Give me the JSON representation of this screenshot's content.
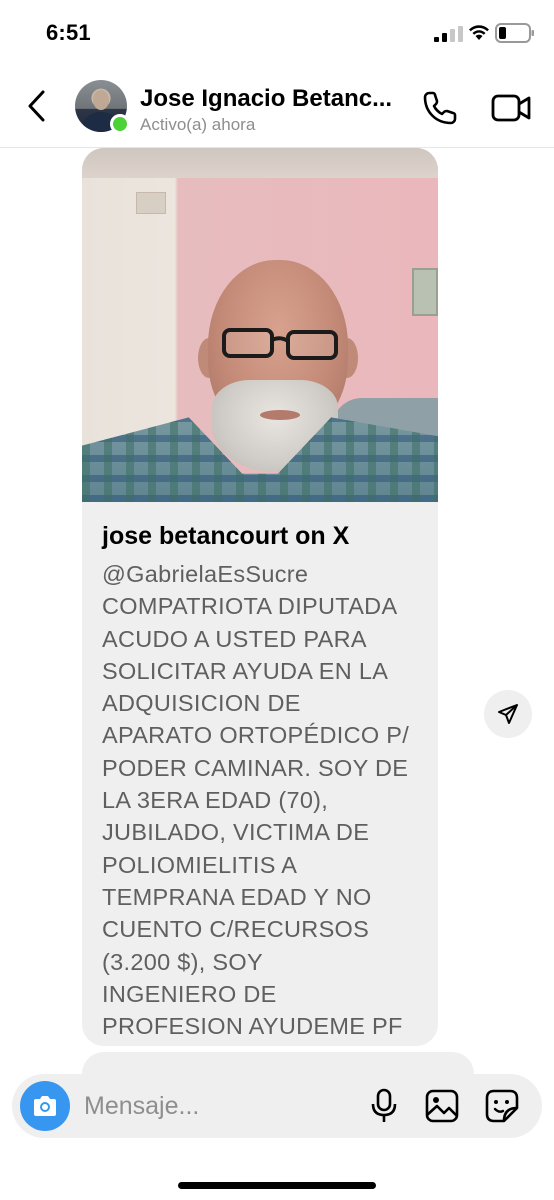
{
  "status_bar": {
    "time": "6:51",
    "signal_icon": "cellular-signal-icon",
    "wifi_icon": "wifi-icon",
    "battery_icon": "battery-low-icon"
  },
  "header": {
    "back_icon": "chevron-left-icon",
    "contact_name": "Jose Ignacio Betanc...",
    "contact_status": "Activo(a) ahora",
    "online_color": "#4cd137",
    "call_icon": "phone-icon",
    "video_icon": "video-camera-icon"
  },
  "message": {
    "shared_post": {
      "image": "profile-photo-of-older-man-with-glasses",
      "title": "jose betancourt on X",
      "text": "@GabrielaEsSucre\nCOMPATRIOTA DIPUTADA\nACUDO A USTED PARA\nSOLICITAR AYUDA EN LA\nADQUISICION DE\nAPARATO ORTOPÉDICO P/\nPODER CAMINAR. SOY DE\nLA 3ERA EDAD (70),\nJUBILADO, VICTIMA DE\nPOLIOMIELITIS A\nTEMPRANA EDAD Y NO\nCUENTO C/RECURSOS\n(3.200 $), SOY\nINGENIERO DE\nPROFESION AYUDEME PF"
    },
    "share_icon": "send-paper-plane-icon",
    "bubble_color": "#efefef"
  },
  "composer": {
    "camera_icon": "camera-icon",
    "camera_color": "#3797f0",
    "placeholder": "Mensaje...",
    "mic_icon": "microphone-icon",
    "gallery_icon": "image-gallery-icon",
    "sticker_icon": "sticker-icon"
  }
}
